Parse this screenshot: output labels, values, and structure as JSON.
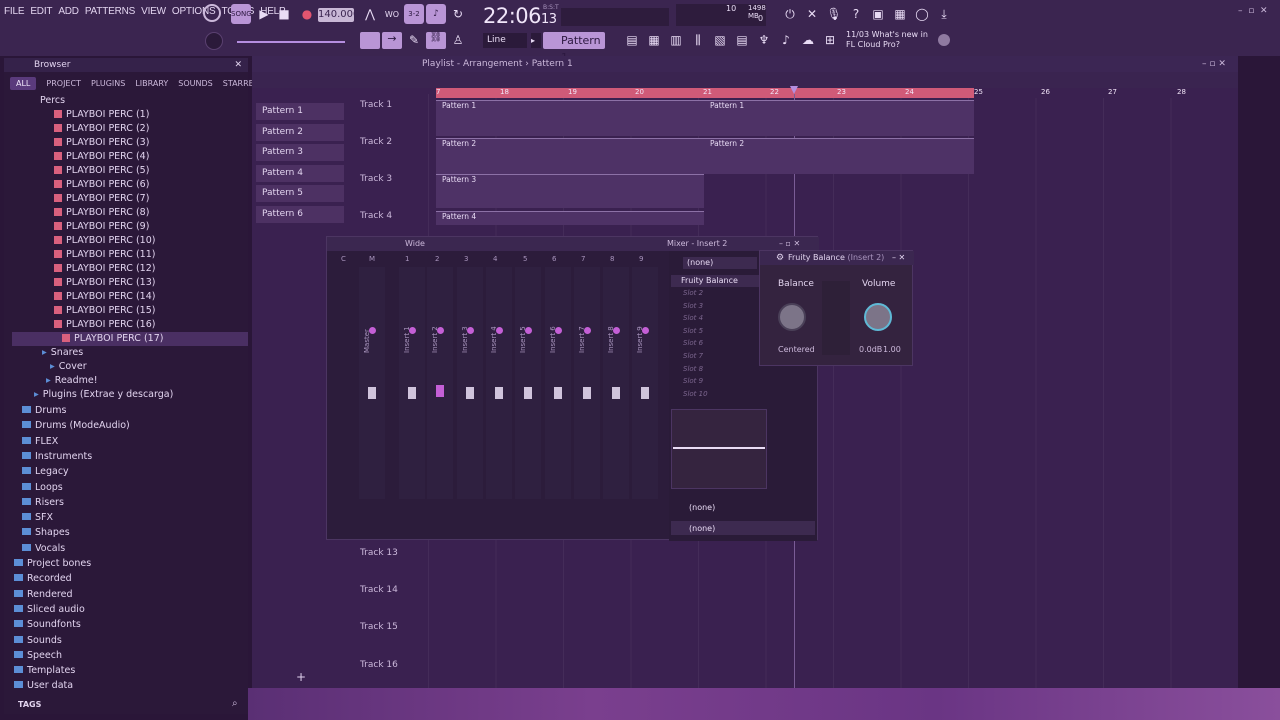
{
  "menu": [
    "FILE",
    "EDIT",
    "ADD",
    "PATTERNS",
    "VIEW",
    "OPTIONS",
    "TOOLS",
    "HELP"
  ],
  "transport": {
    "tempo": "140.000",
    "time": "22:06",
    "time_frac": "13",
    "time_sub": "B:S:T",
    "memory": "1498 MB",
    "cpu": "10",
    "polyphony": "0"
  },
  "toolbar": {
    "snap": "Line",
    "pattern": "Pattern 1"
  },
  "news": {
    "date": "11/03",
    "text": "What's new in FL Cloud Pro?"
  },
  "browser": {
    "title": "Browser",
    "tabs": [
      "ALL",
      "PROJECT",
      "PLUGINS",
      "LIBRARY",
      "SOUNDS",
      "STARRED"
    ],
    "perc_folder": "Percs",
    "perc_items": [
      "PLAYBOI PERC (1)",
      "PLAYBOI PERC (2)",
      "PLAYBOI PERC (3)",
      "PLAYBOI PERC (4)",
      "PLAYBOI PERC (5)",
      "PLAYBOI PERC (6)",
      "PLAYBOI PERC (7)",
      "PLAYBOI PERC (8)",
      "PLAYBOI PERC (9)",
      "PLAYBOI PERC (10)",
      "PLAYBOI PERC (11)",
      "PLAYBOI PERC (12)",
      "PLAYBOI PERC (13)",
      "PLAYBOI PERC (14)",
      "PLAYBOI PERC (15)",
      "PLAYBOI PERC (16)",
      "PLAYBOI PERC (17)"
    ],
    "after_items": [
      "Snares",
      "Cover",
      "Readme!",
      "Plugins (Extrae y descarga)"
    ],
    "folders": [
      "Drums",
      "Drums (ModeAudio)",
      "FLEX",
      "Instruments",
      "Legacy",
      "Loops",
      "Risers",
      "SFX",
      "Shapes",
      "Vocals",
      "Project bones",
      "Recorded",
      "Rendered",
      "Sliced audio",
      "Soundfonts",
      "Sounds",
      "Speech",
      "Templates",
      "User data"
    ],
    "footer": "TAGS"
  },
  "playlist": {
    "title": "Playlist - Arrangement",
    "pattern": "Pattern 1",
    "patterns": [
      "Pattern 1",
      "Pattern 2",
      "Pattern 3",
      "Pattern 4",
      "Pattern 5",
      "Pattern 6"
    ],
    "tracks_top": [
      "Track 1",
      "Track 2",
      "Track 3",
      "Track 4"
    ],
    "tracks_bottom": [
      "Track 13",
      "Track 14",
      "Track 15",
      "Track 16"
    ],
    "ticks": [
      "7",
      "18",
      "19",
      "20",
      "21",
      "22",
      "23",
      "24",
      "25",
      "26",
      "27",
      "28"
    ],
    "clips": [
      "Pattern 1",
      "Pattern 1",
      "Pattern 2",
      "Pattern 2",
      "Pattern 3",
      "Pattern 4"
    ]
  },
  "mixer": {
    "title": "Mixer - Insert 2",
    "mode": "Wide",
    "strips": [
      "Master",
      "Insert 1",
      "Insert 2",
      "Insert 3",
      "Insert 4",
      "Insert 5",
      "Insert 6",
      "Insert 7",
      "Insert 8",
      "Insert 9"
    ],
    "strip_numbers": [
      "C",
      "M",
      "1",
      "2",
      "3",
      "4",
      "5",
      "6",
      "7",
      "8",
      "9"
    ],
    "input": "(none)",
    "slot1": "Fruity Balance",
    "slots": [
      "Slot 2",
      "Slot 3",
      "Slot 4",
      "Slot 5",
      "Slot 6",
      "Slot 7",
      "Slot 8",
      "Slot 9",
      "Slot 10"
    ],
    "output1": "(none)",
    "output2": "(none)"
  },
  "plugin": {
    "title": "Fruity Balance",
    "subtitle": "(Insert 2)",
    "balance_label": "Balance",
    "volume_label": "Volume",
    "balance_value": "Centered",
    "volume_value": "0.0dB",
    "volume_ratio": "1.00"
  }
}
